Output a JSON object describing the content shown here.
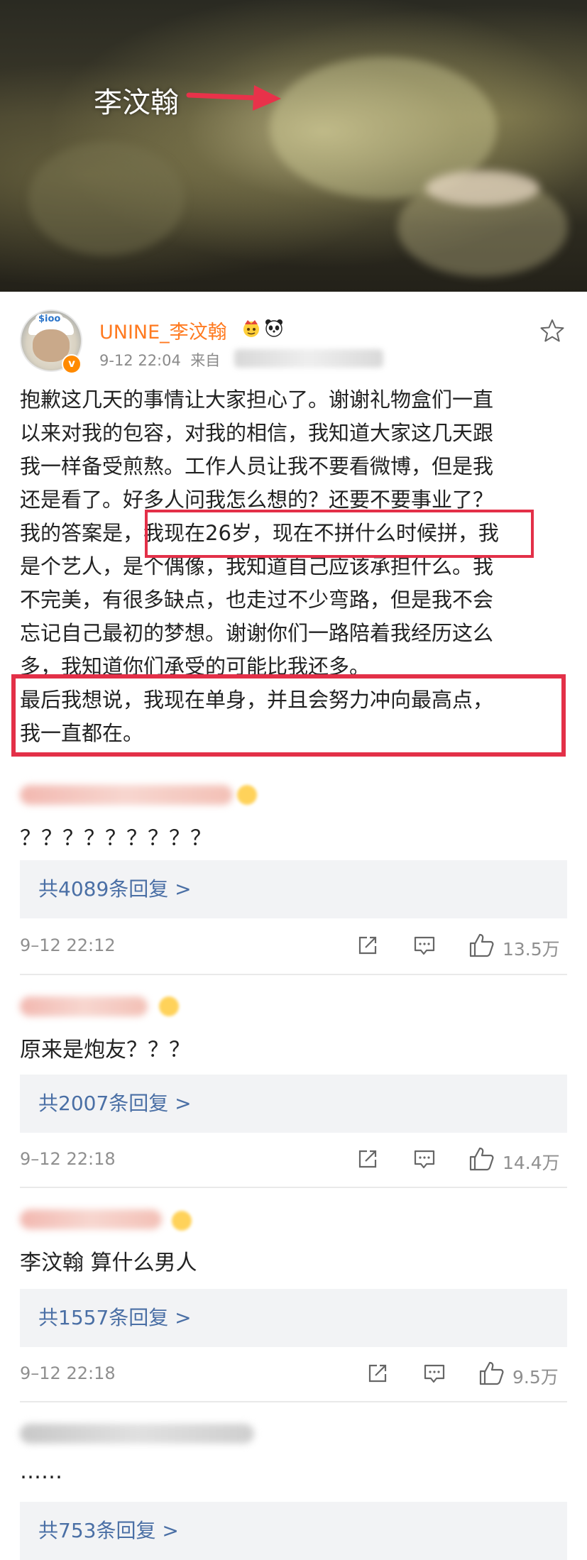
{
  "photo": {
    "label": "李汶翰"
  },
  "post": {
    "username": "UNINE_李汶翰",
    "date": "9-12 22:04",
    "source_prefix": "来自",
    "lines": [
      "抱歉这几天的事情让大家担心了。谢谢礼物盒们一直",
      "以来对我的包容，对我的相信，我知道大家这几天跟",
      "我一样备受煎熬。工作人员让我不要看微博，但是我",
      "还是看了。好多人问我怎么想的？还要不要事业了？",
      "我的答案是，我现在26岁，现在不拼什么时候拼，我",
      "是个艺人，是个偶像，我知道自己应该承担什么。我",
      "不完美，有很多缺点，也走过不少弯路，但是我不会",
      "忘记自己最初的梦想。谢谢你们一路陪着我经历这么",
      "多，我知道你们承受的可能比我还多。",
      "最后我想说，我现在单身，并且会努力冲向最高点，",
      "我一直都在。"
    ]
  },
  "comments": [
    {
      "text": "？？？？？？？？？",
      "replies": "共4089条回复 >",
      "time": "9–12 22:12",
      "likes": "13.5万"
    },
    {
      "text": "原来是炮友？？？",
      "replies": "共2007条回复 >",
      "time": "9–12 22:18",
      "likes": "14.4万"
    },
    {
      "text": "李汶翰  算什么男人",
      "replies": "共1557条回复 >",
      "time": "9–12 22:18",
      "likes": "9.5万"
    },
    {
      "text": "……",
      "replies": "共753条回复 >"
    }
  ],
  "icons": {
    "star": "star-icon",
    "share": "share-icon",
    "comment": "comment-icon",
    "like": "thumbs-up-icon"
  },
  "colors": {
    "username": "#ff7a20",
    "highlight": "#e33048",
    "reply_link": "#4a6fa5"
  }
}
